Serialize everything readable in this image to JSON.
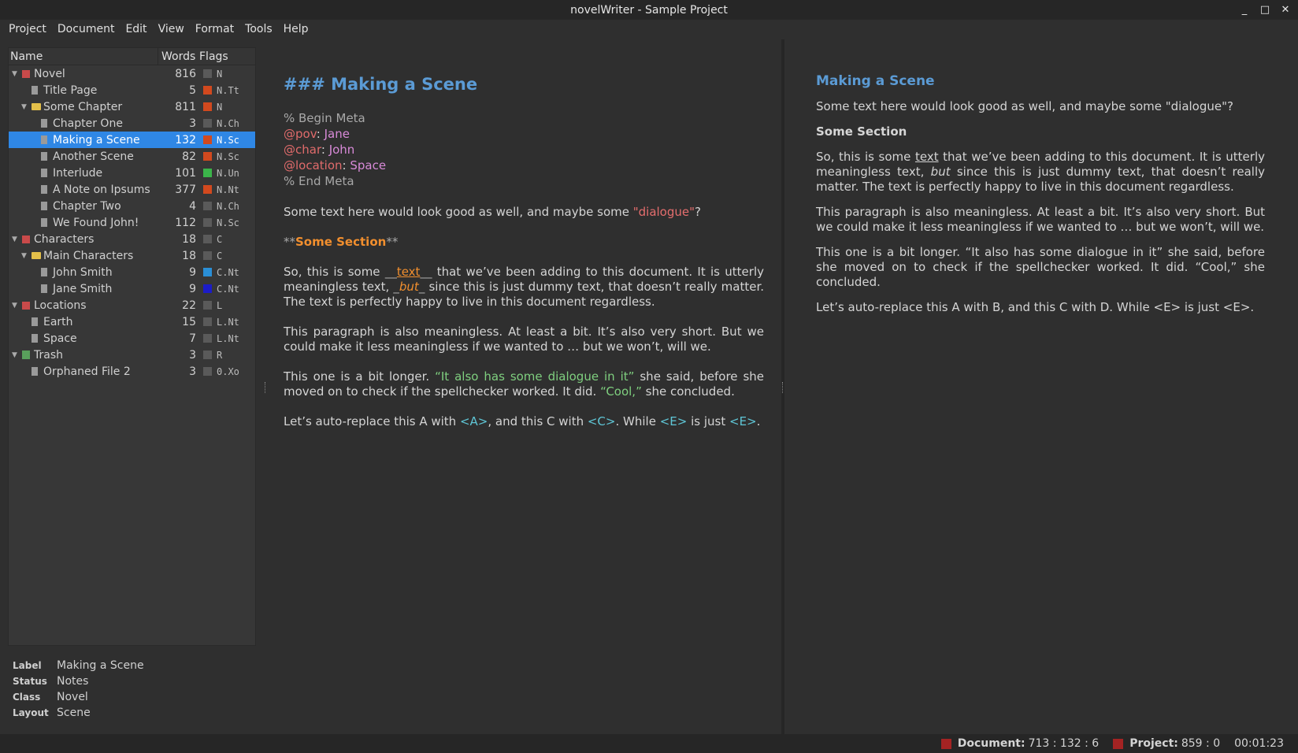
{
  "window": {
    "title": "novelWriter - Sample Project",
    "minimize": "_",
    "maximize": "□",
    "close": "✕"
  },
  "menu": [
    "Project",
    "Document",
    "Edit",
    "View",
    "Format",
    "Tools",
    "Help"
  ],
  "tree": {
    "headers": {
      "name": "Name",
      "words": "Words",
      "flags": "Flags"
    },
    "rows": [
      {
        "label": "Novel",
        "words": "816",
        "flag": "N",
        "swatch": "#5a5a5a",
        "indent": 0,
        "type": "root",
        "expanded": true
      },
      {
        "label": "Title Page",
        "words": "5",
        "flag": "N.Tt",
        "swatch": "#d2491e",
        "indent": 1,
        "type": "file"
      },
      {
        "label": "Some Chapter",
        "words": "811",
        "flag": "N",
        "swatch": "#d2491e",
        "indent": 1,
        "type": "folder",
        "expanded": true
      },
      {
        "label": "Chapter One",
        "words": "3",
        "flag": "N.Ch",
        "swatch": "#5a5a5a",
        "indent": 2,
        "type": "file"
      },
      {
        "label": "Making a Scene",
        "words": "132",
        "flag": "N.Sc",
        "swatch": "#d2491e",
        "indent": 2,
        "type": "file",
        "selected": true
      },
      {
        "label": "Another Scene",
        "words": "82",
        "flag": "N.Sc",
        "swatch": "#d2491e",
        "indent": 2,
        "type": "file"
      },
      {
        "label": "Interlude",
        "words": "101",
        "flag": "N.Un",
        "swatch": "#3bb54a",
        "indent": 2,
        "type": "file"
      },
      {
        "label": "A Note on Ipsums",
        "words": "377",
        "flag": "N.Nt",
        "swatch": "#d2491e",
        "indent": 2,
        "type": "file"
      },
      {
        "label": "Chapter Two",
        "words": "4",
        "flag": "N.Ch",
        "swatch": "#5a5a5a",
        "indent": 2,
        "type": "file"
      },
      {
        "label": "We Found John!",
        "words": "112",
        "flag": "N.Sc",
        "swatch": "#5a5a5a",
        "indent": 2,
        "type": "file"
      },
      {
        "label": "Characters",
        "words": "18",
        "flag": "C",
        "swatch": "#5a5a5a",
        "indent": 0,
        "type": "root",
        "expanded": true
      },
      {
        "label": "Main Characters",
        "words": "18",
        "flag": "C",
        "swatch": "#5a5a5a",
        "indent": 1,
        "type": "folder",
        "expanded": true
      },
      {
        "label": "John Smith",
        "words": "9",
        "flag": "C.Nt",
        "swatch": "#2a8fd6",
        "indent": 2,
        "type": "file"
      },
      {
        "label": "Jane Smith",
        "words": "9",
        "flag": "C.Nt",
        "swatch": "#1c1cc8",
        "indent": 2,
        "type": "file"
      },
      {
        "label": "Locations",
        "words": "22",
        "flag": "L",
        "swatch": "#5a5a5a",
        "indent": 0,
        "type": "root",
        "expanded": true
      },
      {
        "label": "Earth",
        "words": "15",
        "flag": "L.Nt",
        "swatch": "#5a5a5a",
        "indent": 1,
        "type": "file"
      },
      {
        "label": "Space",
        "words": "7",
        "flag": "L.Nt",
        "swatch": "#5a5a5a",
        "indent": 1,
        "type": "file"
      },
      {
        "label": "Trash",
        "words": "3",
        "flag": "R",
        "swatch": "#5a5a5a",
        "indent": 0,
        "type": "trash",
        "expanded": true
      },
      {
        "label": "Orphaned File 2",
        "words": "3",
        "flag": "0.Xo",
        "swatch": "#5a5a5a",
        "indent": 1,
        "type": "file"
      }
    ]
  },
  "details": [
    {
      "key": "Label",
      "value": "Making a Scene"
    },
    {
      "key": "Status",
      "value": "Notes"
    },
    {
      "key": "Class",
      "value": "Novel"
    },
    {
      "key": "Layout",
      "value": "Scene"
    }
  ],
  "editor": {
    "heading": "### Making a Scene",
    "meta_begin": "% Begin Meta",
    "meta_end": "% End Meta",
    "pov_kw": "@pov",
    "pov_val": "Jane",
    "char_kw": "@char",
    "char_val": "John",
    "loc_kw": "@location",
    "loc_val": "Space",
    "colon": ": ",
    "p1_a": "Some text here would look good as well, and maybe some ",
    "p1_q": "\"dialogue\"",
    "p1_b": "?",
    "section_mk_open": "**",
    "section_text": "Some Section",
    "section_mk_close": "**",
    "p2_a": "So, this is some ",
    "p2_mk1": "__",
    "p2_text": "text",
    "p2_mk2": "__",
    "p2_b": " that we’ve been adding to this document. It is utterly meaningless text, ",
    "p2_mk3": "_",
    "p2_but": "but",
    "p2_mk4": "_",
    "p2_c": " since this is just dummy text, that doesn’t really matter. The text is perfectly happy to live in this document regardless.",
    "p3": "This paragraph is also meaningless. At least a bit. It’s also very short. But we could make it less meaningless if we wanted to … but we won’t, will we.",
    "p4_a": "This one is a bit longer. ",
    "p4_q1": "“It also has some dialogue in it”",
    "p4_b": " she said, before she moved on to check if the spellchecker worked. It did. ",
    "p4_q2": "“Cool,”",
    "p4_c": " she concluded.",
    "p5_a": "Let’s auto-replace this A with ",
    "p5_r1": "<A>",
    "p5_b": ", and this C with ",
    "p5_r2": "<C>",
    "p5_c": ".  While ",
    "p5_r3": "<E>",
    "p5_d": " is just ",
    "p5_r4": "<E>",
    "p5_e": "."
  },
  "viewer": {
    "heading": "Making a Scene",
    "p1": "Some text here would look good as well, and maybe some \"dialogue\"?",
    "section": "Some Section",
    "p2_a": "So, this is some ",
    "p2_text": "text",
    "p2_b": " that we’ve been adding to this document. It is utterly meaningless text, ",
    "p2_but": "but",
    "p2_c": " since this is just dummy text, that doesn’t really matter. The text is perfectly happy to live in this document regardless.",
    "p3": "This paragraph is also meaningless. At least a bit. It’s also very short. But we could make it less meaningless if we wanted to … but we won’t, will we.",
    "p4": "This one is a bit longer. “It also has some dialogue in it” she said, before she moved on to check if the spellchecker worked. It did. “Cool,” she concluded.",
    "p5": "Let’s auto-replace this A with B, and this C with D. While <E> is just <E>."
  },
  "status": {
    "doc_label": "Document:",
    "doc_value": "713 : 132 : 6",
    "proj_label": "Project:",
    "proj_value": "859 : 0",
    "time": "00:01:23",
    "led_color": "#a42323"
  }
}
